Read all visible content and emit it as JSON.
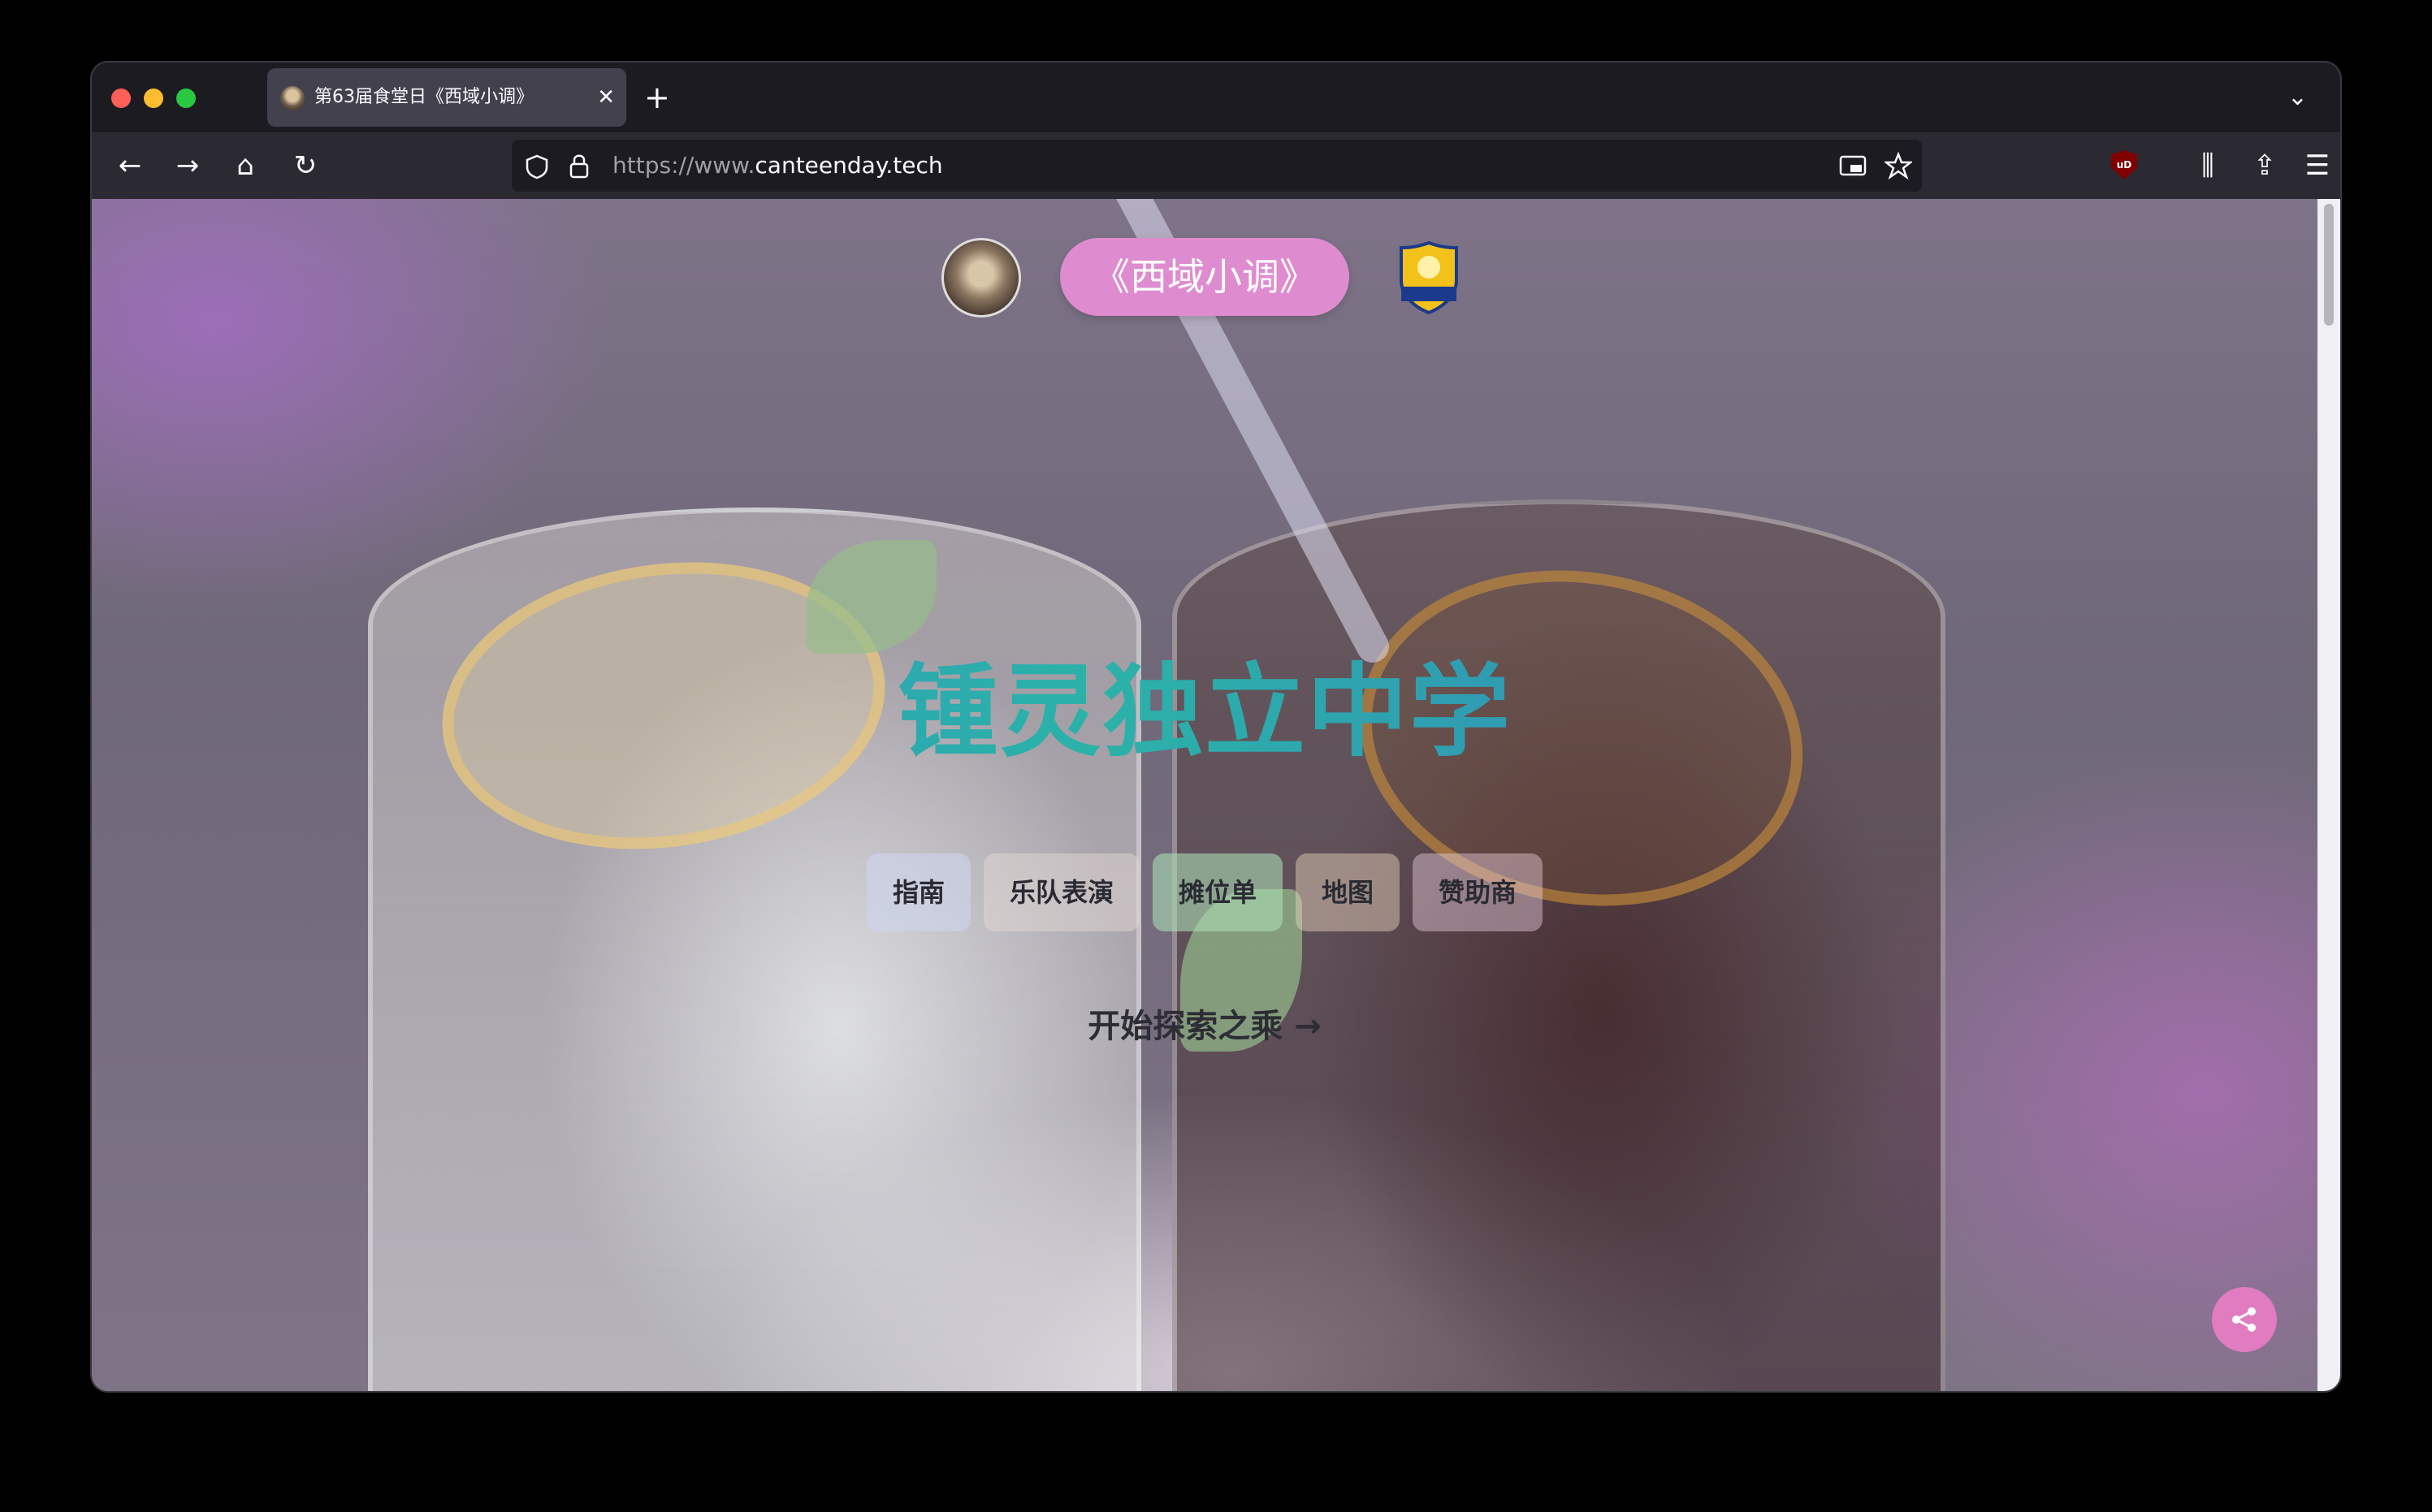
{
  "browser": {
    "tab": {
      "title": "第63届食堂日《西域小调》",
      "close": "✕"
    },
    "new_tab": "+",
    "tab_list": "⌄",
    "nav": {
      "back": "←",
      "forward": "→",
      "home": "⌂",
      "reload": "↻"
    },
    "url": {
      "prefix": "https://www.",
      "domain": "canteenday.tech"
    },
    "extension_badge": "uD",
    "toolbar": {
      "library": "⫼",
      "extensions": "⇪",
      "menu": "☰"
    }
  },
  "page": {
    "header": {
      "event_title": "《西域小调》"
    },
    "school_name": "锺灵独立中学",
    "nav_links": [
      "指南",
      "乐队表演",
      "摊位单",
      "地图",
      "赞助商"
    ],
    "cta": "开始探索之乘 →",
    "share_icon": "share-icon"
  },
  "colors": {
    "title_pill": "#de8ccf",
    "share_button": "#e07cbf",
    "school_name_gradient_start": "#2f88c8",
    "school_name_gradient_end": "#2bb2a8"
  }
}
